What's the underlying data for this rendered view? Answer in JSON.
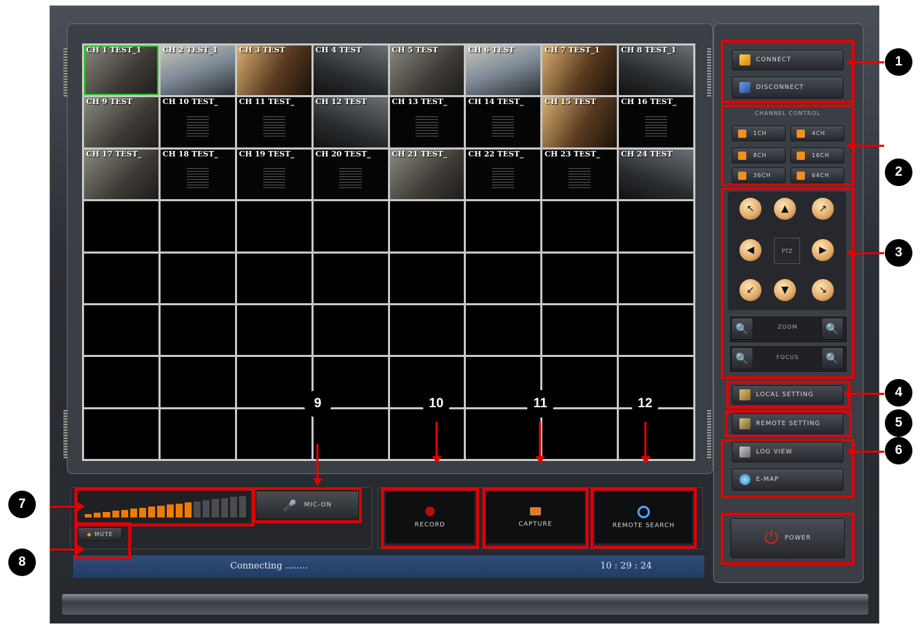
{
  "channels": [
    {
      "label": "CH 1 TEST_1",
      "type": "cam"
    },
    {
      "label": "CH 2 TEST_1",
      "type": "cam"
    },
    {
      "label": "CH 3 TEST",
      "type": "cam"
    },
    {
      "label": "CH 4 TEST",
      "type": "cam"
    },
    {
      "label": "CH 5 TEST",
      "type": "cam"
    },
    {
      "label": "CH 6 TEST",
      "type": "cam"
    },
    {
      "label": "CH 7 TEST_1",
      "type": "cam"
    },
    {
      "label": "CH 8 TEST_1",
      "type": "cam"
    },
    {
      "label": "CH 9 TEST",
      "type": "cam"
    },
    {
      "label": "CH 10 TEST_",
      "type": "text"
    },
    {
      "label": "CH 11 TEST_",
      "type": "text"
    },
    {
      "label": "CH 12 TEST",
      "type": "cam"
    },
    {
      "label": "CH 13 TEST_",
      "type": "text"
    },
    {
      "label": "CH 14 TEST_",
      "type": "text"
    },
    {
      "label": "CH 15 TEST",
      "type": "cam"
    },
    {
      "label": "CH 16 TEST_",
      "type": "text"
    },
    {
      "label": "CH 17 TEST_",
      "type": "cam"
    },
    {
      "label": "CH 18 TEST_",
      "type": "text"
    },
    {
      "label": "CH 19 TEST_",
      "type": "text"
    },
    {
      "label": "CH 20 TEST_",
      "type": "text"
    },
    {
      "label": "CH 21 TEST_",
      "type": "cam"
    },
    {
      "label": "CH 22 TEST_",
      "type": "text"
    },
    {
      "label": "CH 23 TEST_",
      "type": "text"
    },
    {
      "label": "CH 24 TEST",
      "type": "cam"
    }
  ],
  "sidebar": {
    "connect": "CONNECT",
    "disconnect": "DISCONNECT",
    "channel_control_title": "CHANNEL CONTROL",
    "layouts": [
      "1CH",
      "4CH",
      "8CH",
      "16CH",
      "36CH",
      "64CH"
    ],
    "ptz_label": "PTZ",
    "zoom_label": "ZOOM",
    "focus_label": "FOCUS",
    "local_setting": "LOCAL SETTING",
    "remote_setting": "REMOTE SETTING",
    "log_view": "LOG VIEW",
    "emap": "E-MAP",
    "power": "POWER"
  },
  "bottom": {
    "mic_on": "MIC-ON",
    "mute": "MUTE",
    "record": "RECORD",
    "capture": "CAPTURE",
    "remote_search": "REMOTE SEARCH",
    "volume_level_fraction": 0.64
  },
  "status": {
    "message": "Connecting ........",
    "time": "10 : 29 : 24"
  },
  "callouts": [
    "1",
    "2",
    "3",
    "4",
    "5",
    "6",
    "7",
    "8",
    "9",
    "10",
    "11",
    "12"
  ],
  "colors": {
    "accent_red": "#e00000",
    "status_bar": "#2f4d7a",
    "selected_channel": "#27c227",
    "volume_active": "#f07a00"
  }
}
